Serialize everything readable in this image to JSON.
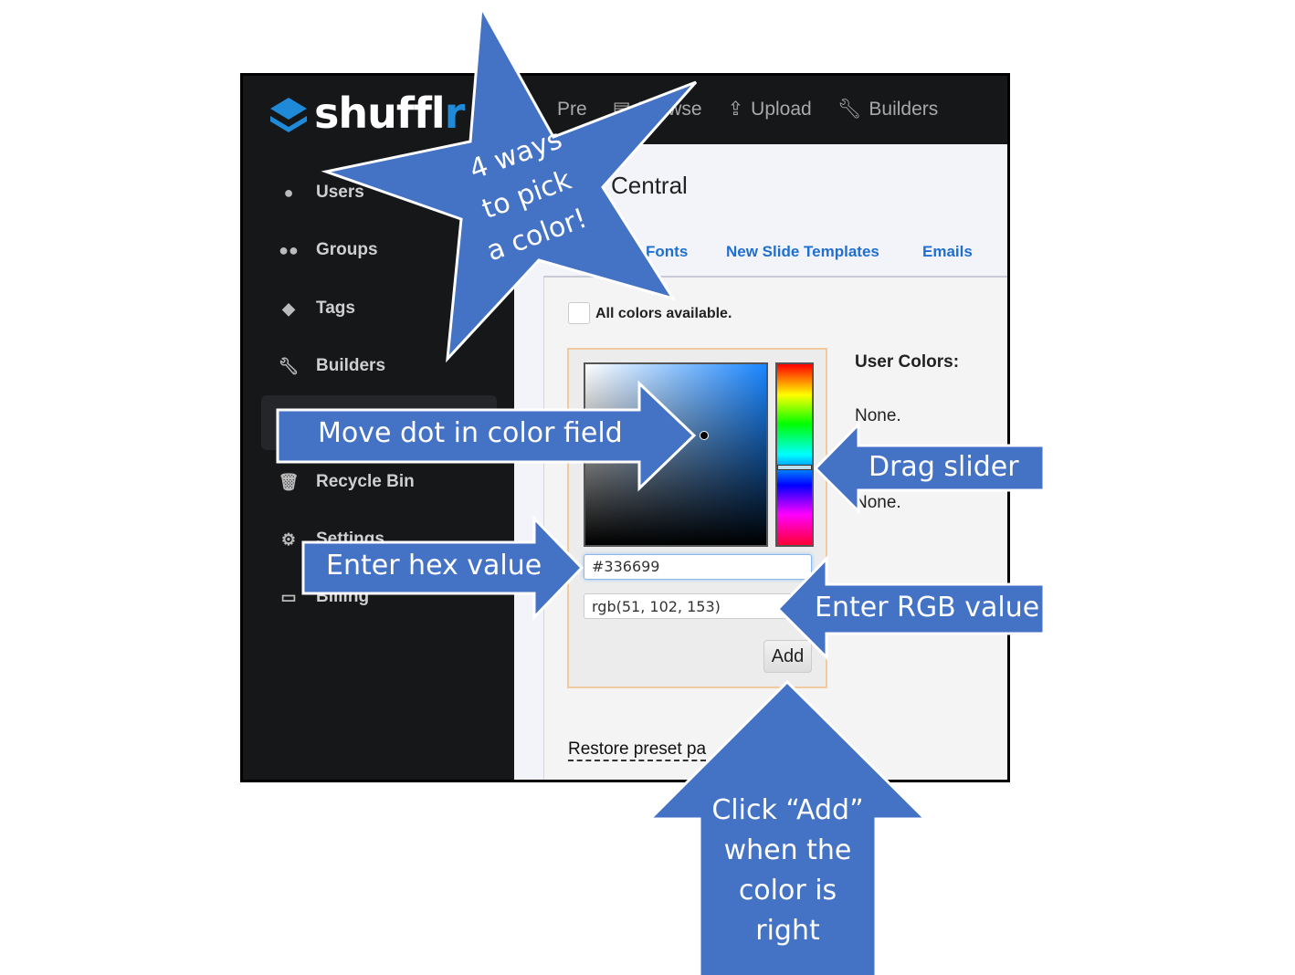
{
  "app": {
    "logo_main": "shuffl",
    "logo_accent": "r",
    "nav": [
      {
        "label": "Pre",
        "icon": "presentation-icon"
      },
      {
        "label": "Browse",
        "icon": "file-icon"
      },
      {
        "label": "Upload",
        "icon": "upload-icon"
      },
      {
        "label": "Builders",
        "icon": "wrench-icon"
      }
    ],
    "sidebar": [
      {
        "label": "Users",
        "icon": "user-icon"
      },
      {
        "label": "Groups",
        "icon": "users-icon"
      },
      {
        "label": "Tags",
        "icon": "tags-icon"
      },
      {
        "label": "Builders",
        "icon": "wrench-icon"
      },
      {
        "label": "",
        "icon": ""
      },
      {
        "label": "Recycle Bin",
        "icon": "trash-icon"
      },
      {
        "label": "Settings",
        "icon": "gears-icon"
      },
      {
        "label": "Billing",
        "icon": "money-icon"
      }
    ],
    "page_title": "Central",
    "tabs": [
      "Fonts",
      "New Slide Templates",
      "Emails"
    ],
    "all_colors_label": "All colors available.",
    "hex_value": "#336699",
    "rgb_value": "rgb(51, 102, 153)",
    "add_label": "Add",
    "user_colors_label": "User Colors:",
    "user_colors_value": "None.",
    "second_value": "None.",
    "restore_label": "Restore preset pa",
    "hue_position_fraction": 0.57,
    "accent": "#1f6fd0"
  },
  "annotations": {
    "star": [
      "4 ways",
      "to pick",
      "a color!"
    ],
    "move_dot": "Move dot in color field",
    "drag_slider": "Drag slider",
    "hex": "Enter hex value",
    "rgb": "Enter RGB value",
    "add": [
      "Click “Add”",
      "when the",
      "color is",
      "right"
    ],
    "color": "#4472c4"
  }
}
